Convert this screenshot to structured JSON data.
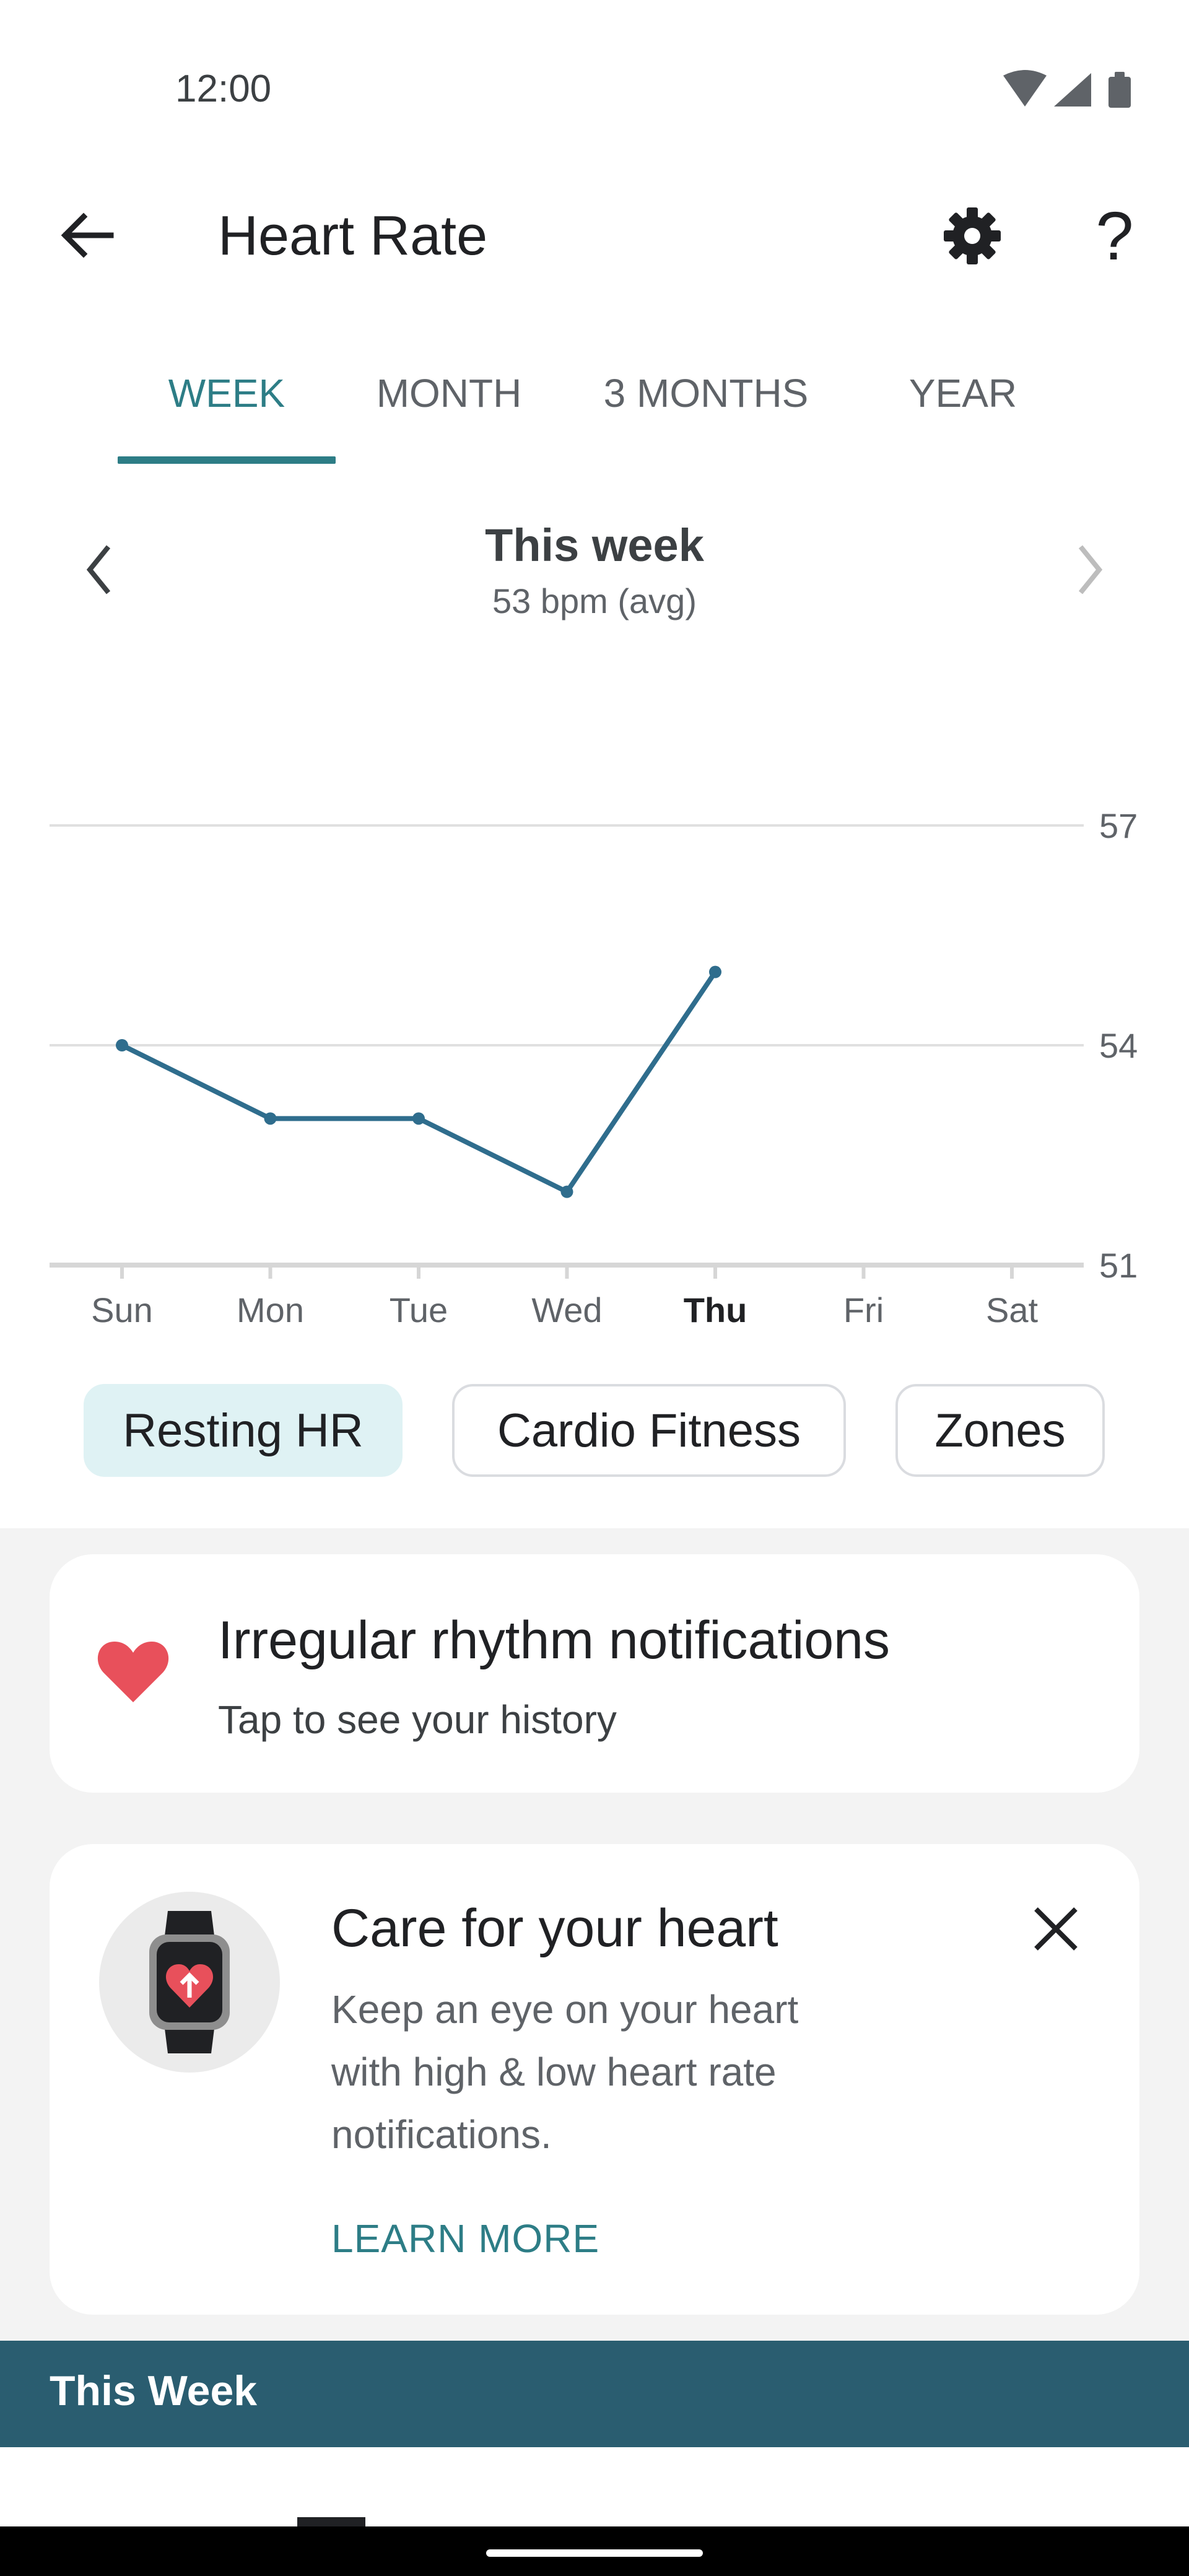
{
  "status_bar": {
    "time": "12:00",
    "icons": [
      "wifi-icon",
      "signal-icon",
      "battery-icon"
    ]
  },
  "app_bar": {
    "title": "Heart Rate",
    "back_icon": "arrow-back-icon",
    "settings_icon": "gear-icon",
    "help_label": "?"
  },
  "tabs": [
    {
      "label": "WEEK",
      "active": true
    },
    {
      "label": "MONTH",
      "active": false
    },
    {
      "label": "3 MONTHS",
      "active": false
    },
    {
      "label": "YEAR",
      "active": false
    }
  ],
  "period": {
    "title": "This week",
    "subtitle": "53 bpm (avg)"
  },
  "chart_data": {
    "type": "line",
    "categories": [
      "Sun",
      "Mon",
      "Tue",
      "Wed",
      "Thu",
      "Fri",
      "Sat"
    ],
    "highlight_category": "Thu",
    "series": [
      {
        "values": [
          54,
          53,
          53,
          52,
          55,
          null,
          null
        ]
      }
    ],
    "y_ticks": [
      "57",
      "54",
      "51"
    ],
    "ylim": [
      51,
      57
    ],
    "grid": true,
    "y_axis_side": "right",
    "colors": {
      "line": "#2f6d8d",
      "grid": "#e0e0e0",
      "axis": "#d6d6d6"
    }
  },
  "chips": [
    {
      "label": "Resting HR",
      "selected": true
    },
    {
      "label": "Cardio Fitness",
      "selected": false
    },
    {
      "label": "Zones",
      "selected": false
    }
  ],
  "irregular_card": {
    "icon": "heart-icon",
    "title": "Irregular rhythm notifications",
    "subtitle": "Tap to see your history"
  },
  "care_card": {
    "icon": "watch-heart-icon",
    "title": "Care for your heart",
    "body_lines": [
      "Keep an eye on your heart",
      "with high & low heart rate",
      "notifications."
    ],
    "action": "LEARN MORE",
    "close_icon": "close-icon"
  },
  "week_section": {
    "title": "This Week"
  },
  "colors": {
    "accent": "#2d7d86",
    "heart": "#e8505b",
    "section_bar": "#2a5d70"
  }
}
